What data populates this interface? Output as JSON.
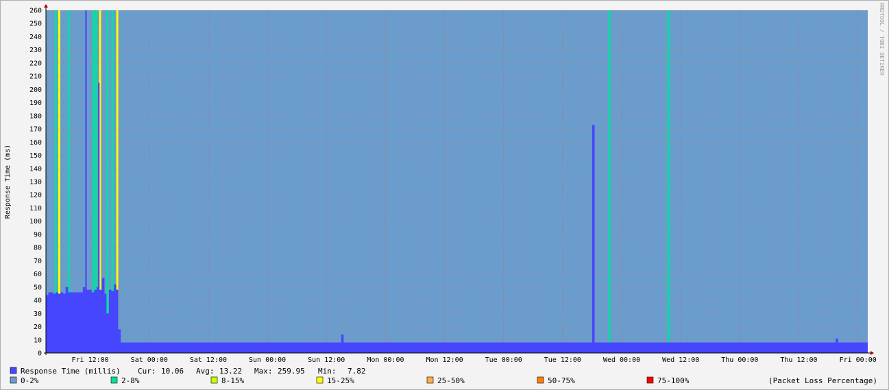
{
  "chart_data": {
    "type": "area",
    "ylabel": "Response Time (ms)",
    "ylim": [
      0,
      260
    ],
    "yticks": [
      0,
      10,
      20,
      30,
      40,
      50,
      60,
      70,
      80,
      90,
      100,
      110,
      120,
      130,
      140,
      150,
      160,
      170,
      180,
      190,
      200,
      210,
      220,
      230,
      240,
      250,
      260
    ],
    "x_range_hours": [
      0,
      167
    ],
    "xticks": [
      {
        "label": "Fri 12:00",
        "hour": 9
      },
      {
        "label": "Sat 00:00",
        "hour": 21
      },
      {
        "label": "Sat 12:00",
        "hour": 33
      },
      {
        "label": "Sun 00:00",
        "hour": 45
      },
      {
        "label": "Sun 12:00",
        "hour": 57
      },
      {
        "label": "Mon 00:00",
        "hour": 69
      },
      {
        "label": "Mon 12:00",
        "hour": 81
      },
      {
        "label": "Tue 00:00",
        "hour": 93
      },
      {
        "label": "Tue 12:00",
        "hour": 105
      },
      {
        "label": "Wed 00:00",
        "hour": 117
      },
      {
        "label": "Wed 12:00",
        "hour": 129
      },
      {
        "label": "Thu 00:00",
        "hour": 141
      },
      {
        "label": "Thu 12:00",
        "hour": 153
      },
      {
        "label": "Fri 00:00",
        "hour": 165
      }
    ],
    "grid": true,
    "background_loss_color": "#6a9ccc",
    "response_series": {
      "name": "Response Time (millis)",
      "color": "#4646ff",
      "points": [
        [
          0.0,
          44
        ],
        [
          0.5,
          46
        ],
        [
          1.0,
          46
        ],
        [
          1.5,
          45
        ],
        [
          2.0,
          46
        ],
        [
          2.5,
          45
        ],
        [
          3.0,
          46
        ],
        [
          3.5,
          45
        ],
        [
          4.0,
          50
        ],
        [
          4.5,
          46
        ],
        [
          5.0,
          46
        ],
        [
          5.5,
          46
        ],
        [
          6.0,
          46
        ],
        [
          6.5,
          46
        ],
        [
          7.0,
          46
        ],
        [
          7.5,
          50
        ],
        [
          8.0,
          259.95
        ],
        [
          8.3,
          48
        ],
        [
          8.8,
          48
        ],
        [
          9.3,
          46
        ],
        [
          9.8,
          48
        ],
        [
          10.3,
          50
        ],
        [
          10.6,
          205
        ],
        [
          10.9,
          48
        ],
        [
          11.4,
          57
        ],
        [
          11.9,
          45
        ],
        [
          12.3,
          30
        ],
        [
          12.8,
          48
        ],
        [
          13.3,
          47
        ],
        [
          13.8,
          52
        ],
        [
          14.3,
          48
        ],
        [
          14.7,
          18
        ],
        [
          15.2,
          8
        ],
        [
          16,
          8
        ],
        [
          20,
          8
        ],
        [
          25,
          8
        ],
        [
          30,
          8
        ],
        [
          35,
          8
        ],
        [
          40,
          8
        ],
        [
          45,
          8
        ],
        [
          50,
          8
        ],
        [
          55,
          8
        ],
        [
          59.5,
          8
        ],
        [
          60.0,
          14
        ],
        [
          60.5,
          8
        ],
        [
          65,
          8
        ],
        [
          70,
          8
        ],
        [
          75,
          8
        ],
        [
          80,
          8
        ],
        [
          85,
          8
        ],
        [
          90,
          8
        ],
        [
          95,
          8
        ],
        [
          100,
          8
        ],
        [
          105,
          8
        ],
        [
          110.5,
          8
        ],
        [
          111.0,
          173
        ],
        [
          111.5,
          8
        ],
        [
          115,
          8
        ],
        [
          120,
          8
        ],
        [
          125,
          8
        ],
        [
          130,
          8
        ],
        [
          135,
          8
        ],
        [
          140,
          8
        ],
        [
          145,
          8
        ],
        [
          150,
          8
        ],
        [
          155,
          8
        ],
        [
          160,
          8
        ],
        [
          160.5,
          11
        ],
        [
          161,
          8
        ],
        [
          165,
          8
        ],
        [
          167,
          8
        ]
      ]
    },
    "packet_loss_markers": [
      {
        "hour": 2.0,
        "color": "#00e0a0"
      },
      {
        "hour": 2.7,
        "color": "#ffff00"
      },
      {
        "hour": 4.6,
        "color": "#00e0a0"
      },
      {
        "hour": 9.7,
        "color": "#00e0a0"
      },
      {
        "hour": 10.2,
        "color": "#00e0a0"
      },
      {
        "hour": 11.0,
        "color": "#ffff00"
      },
      {
        "hour": 12.5,
        "color": "#00e0a0"
      },
      {
        "hour": 13.5,
        "color": "#00e0a0"
      },
      {
        "hour": 14.5,
        "color": "#ffff00"
      },
      {
        "hour": 114.5,
        "color": "#00e0a0"
      },
      {
        "hour": 126.5,
        "color": "#00e0a0"
      }
    ],
    "summary": {
      "label": "Response Time (millis)",
      "cur_label": "Cur:",
      "cur": "10.06",
      "avg_label": "Avg:",
      "avg": "13.22",
      "max_label": "Max:",
      "max": "259.95",
      "min_label": "Min:",
      "min": "7.82"
    },
    "loss_legend": [
      {
        "label": "0-2%",
        "color": "#6a9ccc"
      },
      {
        "label": "2-8%",
        "color": "#00e0a0"
      },
      {
        "label": "8-15%",
        "color": "#c8ff00"
      },
      {
        "label": "15-25%",
        "color": "#ffff00"
      },
      {
        "label": "25-50%",
        "color": "#ffb040"
      },
      {
        "label": "50-75%",
        "color": "#ff8000"
      },
      {
        "label": "75-100%",
        "color": "#ff0000"
      }
    ],
    "loss_legend_title": "(Packet Loss Percentage)",
    "side_credit": "RRDTOOL / TOBI OETIKER"
  }
}
